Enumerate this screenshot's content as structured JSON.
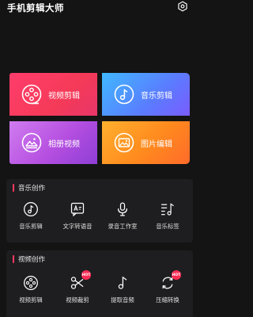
{
  "header": {
    "title": "手机剪辑大师",
    "settings_icon": "gear-icon"
  },
  "grid": {
    "video_edit": "视频剪辑",
    "music_edit": "音乐剪辑",
    "album_video": "相册视频",
    "photo_edit": "图片编辑"
  },
  "music_section": {
    "title": "音乐创作",
    "tools": [
      {
        "label": "音乐剪辑",
        "icon": "music-note-icon"
      },
      {
        "label": "文字转语音",
        "icon": "text-to-speech-icon"
      },
      {
        "label": "录音工作室",
        "icon": "microphone-icon"
      },
      {
        "label": "音乐标签",
        "icon": "music-tag-icon"
      }
    ]
  },
  "video_section": {
    "title": "视频创作",
    "tools": [
      {
        "label": "视频剪辑",
        "icon": "film-reel-icon"
      },
      {
        "label": "视频裁剪",
        "icon": "scissors-icon",
        "badge": "HOT"
      },
      {
        "label": "提取音频",
        "icon": "music-note-icon"
      },
      {
        "label": "压缩转换",
        "icon": "convert-icon",
        "badge": "HOT"
      }
    ]
  },
  "colors": {
    "background": "#141414",
    "accent": "#ff3860",
    "video_tile": "#f53a58",
    "music_tile": "#5a7cff",
    "album_tile": "#b54fe0",
    "photo_tile": "#ff8a1e"
  }
}
